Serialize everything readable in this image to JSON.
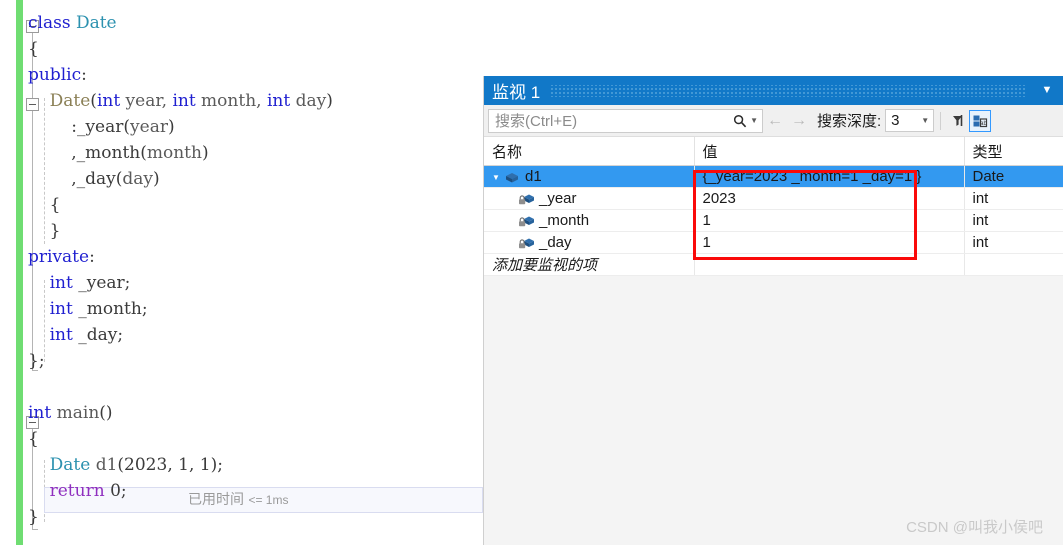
{
  "editor": {
    "lines": [
      {
        "indent": 0,
        "tokens": [
          {
            "t": "class ",
            "c": "kw"
          },
          {
            "t": "Date",
            "c": "type"
          }
        ]
      },
      {
        "indent": 0,
        "tokens": [
          {
            "t": "{",
            "c": "punct"
          }
        ]
      },
      {
        "indent": 0,
        "tokens": [
          {
            "t": "public",
            "c": "kw"
          },
          {
            "t": ":",
            "c": "punct"
          }
        ]
      },
      {
        "indent": 0,
        "tokens": [
          {
            "t": "    ",
            "c": "punct"
          },
          {
            "t": "Date",
            "c": "fn"
          },
          {
            "t": "(",
            "c": "punct"
          },
          {
            "t": "int",
            "c": "kw"
          },
          {
            "t": " year, ",
            "c": "ident"
          },
          {
            "t": "int",
            "c": "kw"
          },
          {
            "t": " month, ",
            "c": "ident"
          },
          {
            "t": "int",
            "c": "kw"
          },
          {
            "t": " day",
            "c": "ident"
          },
          {
            "t": ")",
            "c": "punct"
          }
        ]
      },
      {
        "indent": 0,
        "tokens": [
          {
            "t": "        :_year",
            "c": "field"
          },
          {
            "t": "(",
            "c": "punct"
          },
          {
            "t": "year",
            "c": "ident"
          },
          {
            "t": ")",
            "c": "punct"
          }
        ]
      },
      {
        "indent": 0,
        "tokens": [
          {
            "t": "        ,_month",
            "c": "field"
          },
          {
            "t": "(",
            "c": "punct"
          },
          {
            "t": "month",
            "c": "ident"
          },
          {
            "t": ")",
            "c": "punct"
          }
        ]
      },
      {
        "indent": 0,
        "tokens": [
          {
            "t": "        ,_day",
            "c": "field"
          },
          {
            "t": "(",
            "c": "punct"
          },
          {
            "t": "day",
            "c": "ident"
          },
          {
            "t": ")",
            "c": "punct"
          }
        ]
      },
      {
        "indent": 0,
        "tokens": [
          {
            "t": "    {",
            "c": "punct"
          }
        ]
      },
      {
        "indent": 0,
        "tokens": [
          {
            "t": "    }",
            "c": "punct"
          }
        ]
      },
      {
        "indent": 0,
        "tokens": [
          {
            "t": "private",
            "c": "kw"
          },
          {
            "t": ":",
            "c": "punct"
          }
        ]
      },
      {
        "indent": 0,
        "tokens": [
          {
            "t": "    ",
            "c": "punct"
          },
          {
            "t": "int",
            "c": "kw"
          },
          {
            "t": " _year;",
            "c": "field"
          }
        ]
      },
      {
        "indent": 0,
        "tokens": [
          {
            "t": "    ",
            "c": "punct"
          },
          {
            "t": "int",
            "c": "kw"
          },
          {
            "t": " _month;",
            "c": "field"
          }
        ]
      },
      {
        "indent": 0,
        "tokens": [
          {
            "t": "    ",
            "c": "punct"
          },
          {
            "t": "int",
            "c": "kw"
          },
          {
            "t": " _day;",
            "c": "field"
          }
        ]
      },
      {
        "indent": 0,
        "tokens": [
          {
            "t": "};",
            "c": "punct"
          }
        ]
      },
      {
        "indent": 0,
        "tokens": []
      },
      {
        "indent": 0,
        "tokens": [
          {
            "t": "int",
            "c": "kw"
          },
          {
            "t": " main",
            "c": "ident"
          },
          {
            "t": "()",
            "c": "punct"
          }
        ]
      },
      {
        "indent": 0,
        "tokens": [
          {
            "t": "{",
            "c": "punct"
          }
        ]
      },
      {
        "indent": 0,
        "tokens": [
          {
            "t": "    ",
            "c": "punct"
          },
          {
            "t": "Date",
            "c": "type"
          },
          {
            "t": " d1",
            "c": "ident"
          },
          {
            "t": "(",
            "c": "punct"
          },
          {
            "t": "2023",
            "c": "num"
          },
          {
            "t": ", ",
            "c": "punct"
          },
          {
            "t": "1",
            "c": "num"
          },
          {
            "t": ", ",
            "c": "punct"
          },
          {
            "t": "1",
            "c": "num"
          },
          {
            "t": ");",
            "c": "punct"
          }
        ]
      },
      {
        "indent": 0,
        "tokens": [
          {
            "t": "    ",
            "c": "punct"
          },
          {
            "t": "return",
            "c": "kwp"
          },
          {
            "t": " 0;",
            "c": "num"
          }
        ]
      },
      {
        "indent": 0,
        "tokens": [
          {
            "t": "}",
            "c": "punct"
          }
        ]
      }
    ],
    "elapsed_label": "已用时间",
    "elapsed_value": "<= 1ms"
  },
  "watch": {
    "title": "监视 1",
    "panel_menu_icon": "chevron-down-icon",
    "search": {
      "placeholder": "搜索(Ctrl+E)",
      "value": "",
      "search_icon": "search-icon",
      "dropdown_icon": "chevron-down-icon"
    },
    "nav": {
      "prev_icon": "arrow-left-icon",
      "next_icon": "arrow-right-icon"
    },
    "depth": {
      "label": "搜索深度:",
      "value": "3",
      "dropdown_icon": "chevron-down-icon"
    },
    "toolbar_buttons": [
      {
        "name": "pin-filter-icon",
        "label": ""
      },
      {
        "name": "hex-display-icon",
        "label": ""
      }
    ],
    "columns": [
      "名称",
      "值",
      "类型"
    ],
    "rows": [
      {
        "name": "d1",
        "value": "{_year=2023 _month=1 _day=1 }",
        "type": "Date",
        "icon": "object-cube-icon",
        "expander": "expanded",
        "indent": 0,
        "selected": true,
        "value_changed": false
      },
      {
        "name": "_year",
        "value": "2023",
        "type": "int",
        "icon": "private-field-icon",
        "expander": "none",
        "indent": 1,
        "selected": false,
        "value_changed": true
      },
      {
        "name": "_month",
        "value": "1",
        "type": "int",
        "icon": "private-field-icon",
        "expander": "none",
        "indent": 1,
        "selected": false,
        "value_changed": true
      },
      {
        "name": "_day",
        "value": "1",
        "type": "int",
        "icon": "private-field-icon",
        "expander": "none",
        "indent": 1,
        "selected": false,
        "value_changed": true
      }
    ],
    "add_item_placeholder": "添加要监视的项"
  },
  "annotation": {
    "highlight_color": "#fa0a0a"
  },
  "watermark": "CSDN @叫我小侯吧",
  "colors": {
    "title_bar": "#1178c8",
    "selection": "#3399f0",
    "changed_value": "#d40000",
    "change_bar": "#6fdd72",
    "keyword": "#1f1fd0",
    "type_name": "#2b91af"
  }
}
